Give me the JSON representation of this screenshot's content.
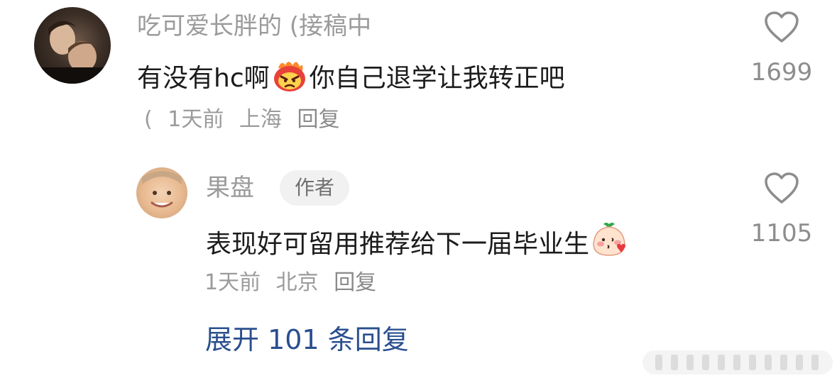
{
  "comment1": {
    "username": "吃可爱长胖的 (接稿中",
    "text_before": "有没有hc啊",
    "emoji": "angry-face-icon",
    "text_after": "你自己退学让我转正吧",
    "paren": "(",
    "time": "1天前",
    "location": "上海",
    "reply": "回复",
    "likes": "1699"
  },
  "comment2": {
    "username": "果盘",
    "badge": "作者",
    "text": "表现好可留用推荐给下一届毕业生",
    "emoji": "blushing-blob-icon",
    "time": "1天前",
    "location": "北京",
    "reply": "回复",
    "likes": "1105"
  },
  "expand_replies": "展开 101 条回复",
  "colors": {
    "username": "#9b9b9b",
    "text": "#1c1c1c",
    "link": "#2a4f8f"
  }
}
